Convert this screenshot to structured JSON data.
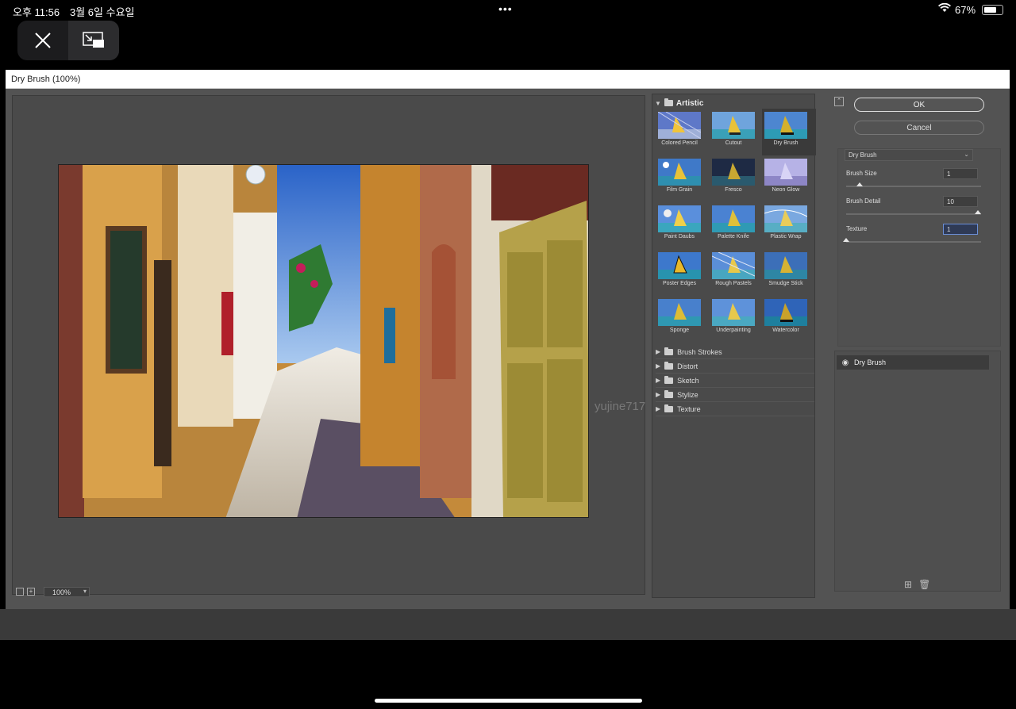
{
  "statusbar": {
    "time": "오후 11:56",
    "date": "3월 6일 수요일",
    "battery_pct": "67%",
    "more_dots": "•••"
  },
  "remote_toolbar": {
    "close_icon": "close-icon",
    "screen_icon": "screen-mode-icon"
  },
  "dialog": {
    "title": "Dry Brush (100%)",
    "zoom": "100%"
  },
  "gallery": {
    "open_category": "Artistic",
    "thumbnails": [
      {
        "label": "Colored Pencil"
      },
      {
        "label": "Cutout"
      },
      {
        "label": "Dry Brush",
        "selected": true
      },
      {
        "label": "Film Grain"
      },
      {
        "label": "Fresco"
      },
      {
        "label": "Neon Glow"
      },
      {
        "label": "Paint Daubs"
      },
      {
        "label": "Palette Knife"
      },
      {
        "label": "Plastic Wrap"
      },
      {
        "label": "Poster Edges"
      },
      {
        "label": "Rough Pastels"
      },
      {
        "label": "Smudge Stick"
      },
      {
        "label": "Sponge"
      },
      {
        "label": "Underpainting"
      },
      {
        "label": "Watercolor"
      }
    ],
    "categories": [
      "Brush Strokes",
      "Distort",
      "Sketch",
      "Stylize",
      "Texture"
    ]
  },
  "panel": {
    "ok_label": "OK",
    "cancel_label": "Cancel",
    "filter_select": "Dry Brush",
    "params": [
      {
        "label": "Brush Size",
        "value": "1",
        "fraction": 0.1
      },
      {
        "label": "Brush Detail",
        "value": "10",
        "fraction": 1.0
      },
      {
        "label": "Texture",
        "value": "1",
        "fraction": 0.0
      }
    ],
    "layer_name": "Dry Brush"
  },
  "watermark": "yujine717"
}
